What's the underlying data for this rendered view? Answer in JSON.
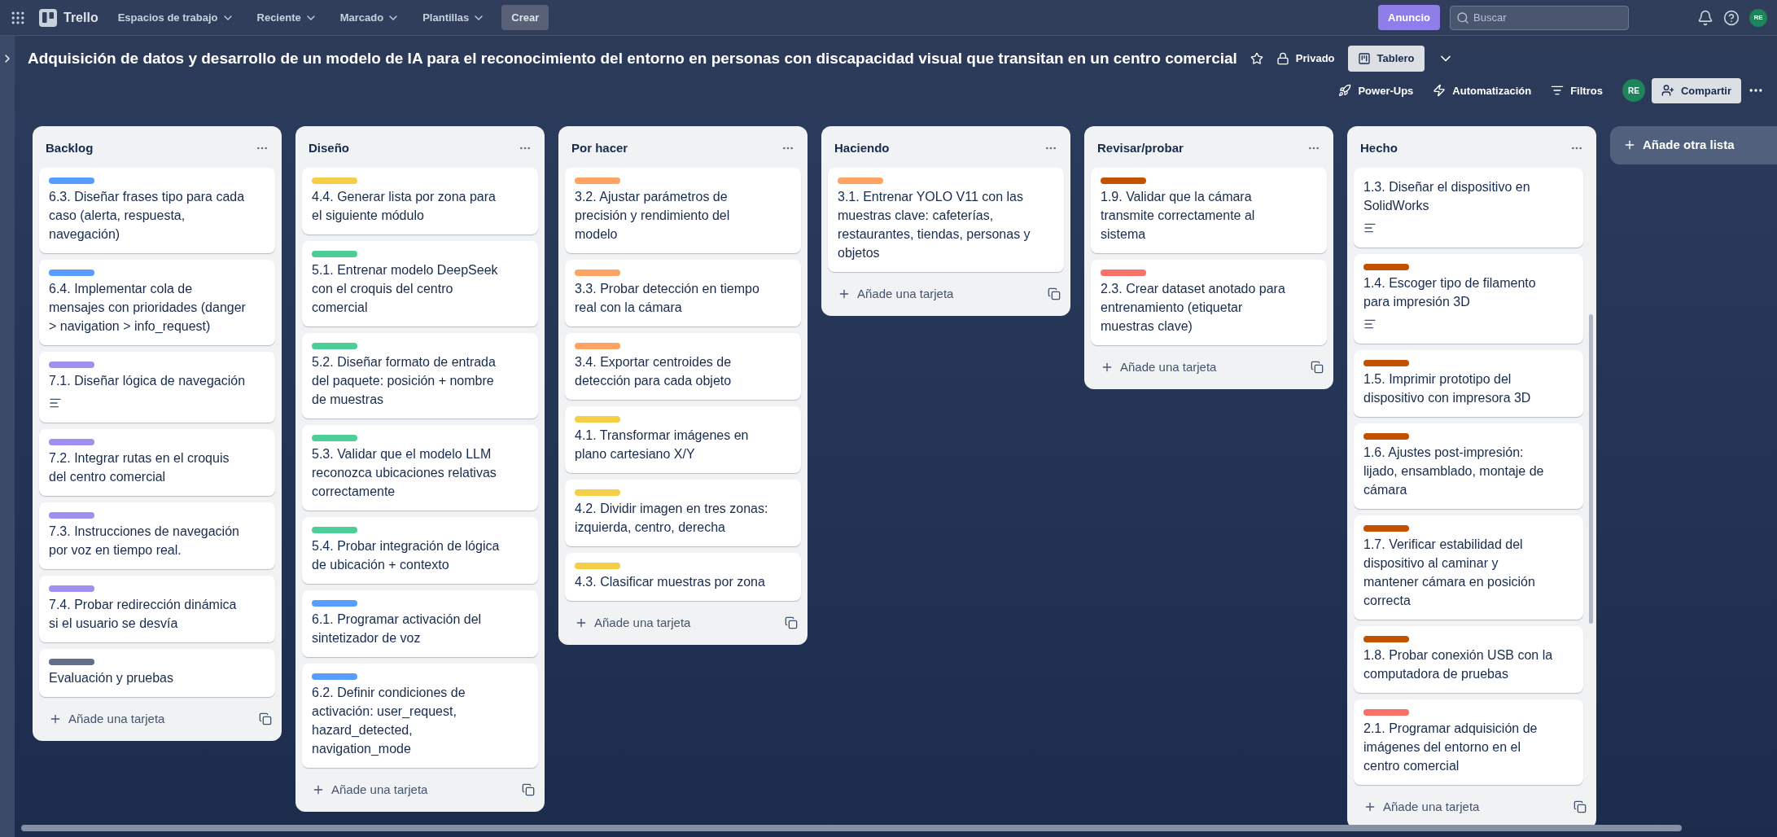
{
  "topbar": {
    "app_name": "Trello",
    "menus": [
      {
        "label": "Espacios de trabajo"
      },
      {
        "label": "Reciente"
      },
      {
        "label": "Marcado"
      },
      {
        "label": "Plantillas"
      }
    ],
    "create_button": "Crear",
    "announce_button": "Anuncio",
    "search": {
      "placeholder": "Buscar"
    },
    "avatar": "RE"
  },
  "board": {
    "title": "Adquisición de datos y desarrollo de un modelo de IA para el reconocimiento del entorno en personas con discapacidad visual que transitan en un centro comercial",
    "visibility": "Privado",
    "views": [
      {
        "label": "Tablero",
        "selected": true
      }
    ],
    "actions": [
      {
        "kind": "powerups",
        "label": "Power-Ups"
      },
      {
        "kind": "automation",
        "label": "Automatización"
      },
      {
        "kind": "filter",
        "label": "Filtros"
      }
    ],
    "member_avatar": "RE",
    "share_button": "Compartir"
  },
  "lists": [
    {
      "title": "Backlog",
      "add_card": "Añade una tarjeta",
      "cards": [
        {
          "color": "#579dff",
          "title": "6.3. Diseñar frases tipo para cada caso (alerta, respuesta, navegación)",
          "has_description": false
        },
        {
          "color": "#579dff",
          "title": "6.4. Implementar cola de mensajes con prioridades (danger > navigation > info_request)",
          "has_description": false
        },
        {
          "color": "#9f8fef",
          "title": "7.1. Diseñar lógica de navegación",
          "has_description": true
        },
        {
          "color": "#9f8fef",
          "title": "7.2. Integrar rutas en el croquis del centro comercial",
          "has_description": false
        },
        {
          "color": "#9f8fef",
          "title": "7.3. Instrucciones de navegación por voz en tiempo real.",
          "has_description": false
        },
        {
          "color": "#9f8fef",
          "title": "7.4. Probar redirección dinámica si el usuario se desvía",
          "has_description": false
        },
        {
          "color": "#626f86",
          "title": "Evaluación y pruebas",
          "has_description": false
        }
      ]
    },
    {
      "title": "Diseño",
      "add_card": "Añade una tarjeta",
      "cards": [
        {
          "color": "#f5cd47",
          "title": "4.4. Generar lista por zona para el siguiente módulo",
          "has_description": false
        },
        {
          "color": "#4bce97",
          "title": "5.1. Entrenar modelo DeepSeek con el croquis del centro comercial",
          "has_description": false
        },
        {
          "color": "#4bce97",
          "title": "5.2. Diseñar formato de entrada del paquete: posición + nombre de muestras",
          "has_description": false
        },
        {
          "color": "#4bce97",
          "title": "5.3. Validar que el modelo LLM reconozca ubicaciones relativas correctamente",
          "has_description": false
        },
        {
          "color": "#4bce97",
          "title": "5.4. Probar integración de lógica de ubicación + contexto",
          "has_description": false
        },
        {
          "color": "#579dff",
          "title": "6.1. Programar activación del sintetizador de voz",
          "has_description": false
        },
        {
          "color": "#579dff",
          "title": "6.2. Definir condiciones de activación: user_request, hazard_detected, navigation_mode",
          "has_description": false
        }
      ]
    },
    {
      "title": "Por hacer",
      "add_card": "Añade una tarjeta",
      "cards": [
        {
          "color": "#fea362",
          "title": "3.2. Ajustar parámetros de precisión y rendimiento del modelo",
          "has_description": false
        },
        {
          "color": "#fea362",
          "title": "3.3. Probar detección en tiempo real con la cámara",
          "has_description": false
        },
        {
          "color": "#fea362",
          "title": "3.4. Exportar centroides de detección para cada objeto",
          "has_description": false
        },
        {
          "color": "#f5cd47",
          "title": "4.1. Transformar imágenes en plano cartesiano X/Y",
          "has_description": false
        },
        {
          "color": "#f5cd47",
          "title": "4.2. Dividir imagen en tres zonas: izquierda, centro, derecha",
          "has_description": false
        },
        {
          "color": "#f5cd47",
          "title": "4.3. Clasificar muestras por zona",
          "has_description": false
        }
      ]
    },
    {
      "title": "Haciendo",
      "add_card": "Añade una tarjeta",
      "cards": [
        {
          "color": "#fea362",
          "title": "3.1. Entrenar YOLO V11 con las muestras clave: cafeterías, restaurantes, tiendas, personas y objetos",
          "has_description": false
        }
      ]
    },
    {
      "title": "Revisar/probar",
      "add_card": "Añade una tarjeta",
      "cards": [
        {
          "color": "#c25100",
          "title": "1.9. Validar que la cámara transmite correctamente al sistema",
          "has_description": false
        },
        {
          "color": "#f87168",
          "title": "2.3. Crear dataset anotado para entrenamiento (etiquetar muestras clave)",
          "has_description": false
        }
      ]
    },
    {
      "title": "Hecho",
      "add_card": "Añade una tarjeta",
      "scrolled": true,
      "cards": [
        {
          "title": "1.3. Diseñar el dispositivo en SolidWorks",
          "has_description": true
        },
        {
          "color": "#c25100",
          "title": "1.4. Escoger tipo de filamento para impresión 3D",
          "has_description": true
        },
        {
          "color": "#c25100",
          "title": "1.5. Imprimir prototipo del dispositivo con impresora 3D",
          "has_description": false
        },
        {
          "color": "#c25100",
          "title": "1.6. Ajustes post-impresión: lijado, ensamblado, montaje de cámara",
          "has_description": false
        },
        {
          "color": "#c25100",
          "title": "1.7. Verificar estabilidad del dispositivo al caminar y mantener cámara en posición correcta",
          "has_description": false
        },
        {
          "color": "#c25100",
          "title": "1.8. Probar conexión USB con la computadora de pruebas",
          "has_description": false
        },
        {
          "color": "#f87168",
          "title": "2.1. Programar adquisición de imágenes del entorno en el centro comercial",
          "has_description": false
        }
      ]
    }
  ],
  "add_list": "Añade otra lista"
}
